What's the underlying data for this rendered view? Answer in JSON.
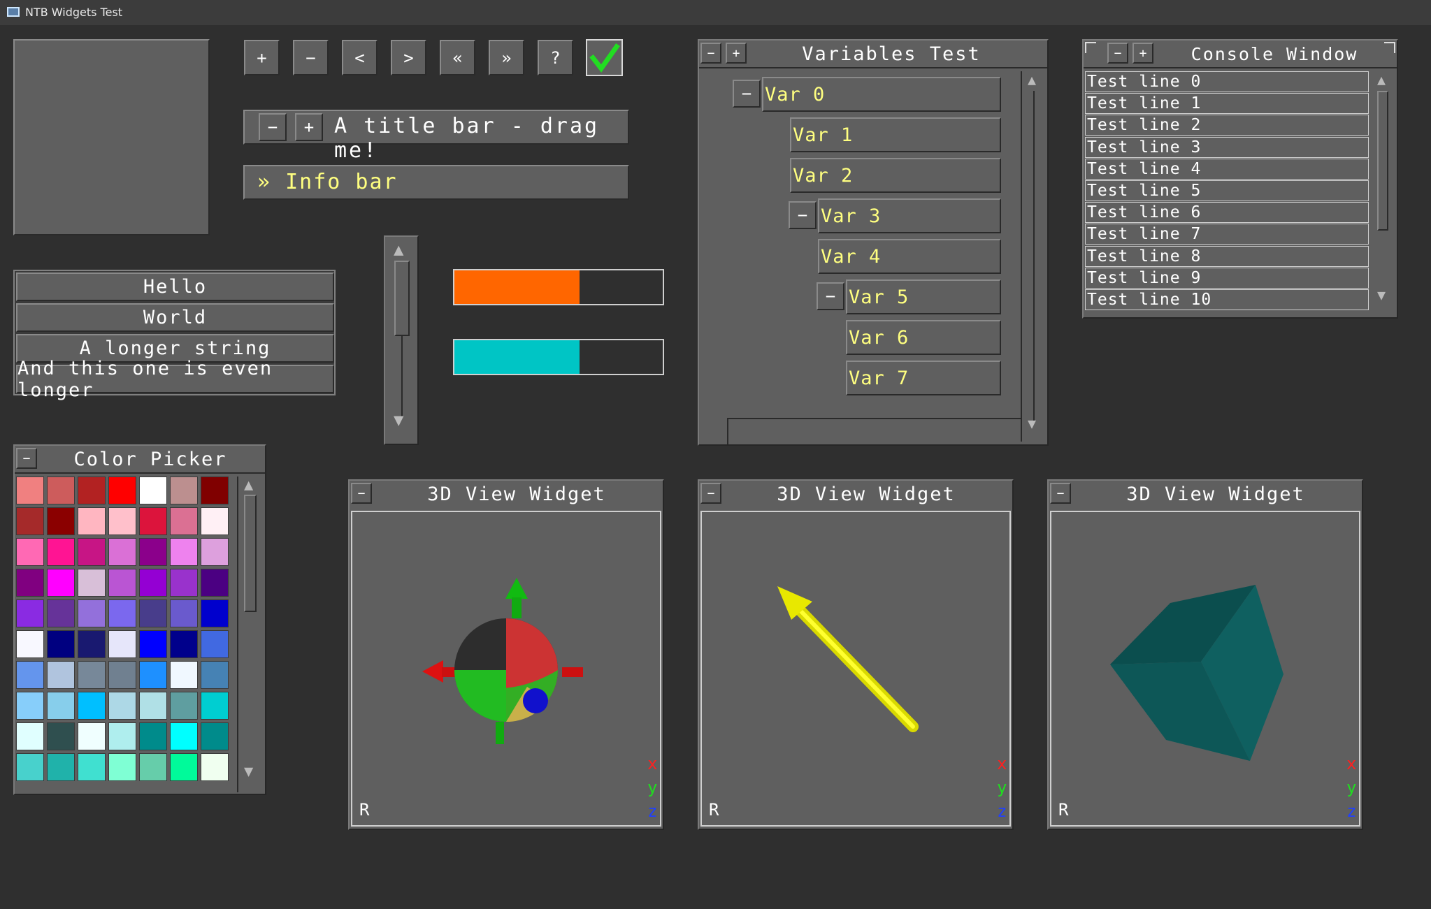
{
  "window": {
    "title": "NTB Widgets Test"
  },
  "toolbar": {
    "buttons": [
      "+",
      "−",
      "<",
      ">",
      "«",
      "»",
      "?"
    ],
    "check_color": "#22dd22"
  },
  "title_bar": {
    "minus": "−",
    "plus": "+",
    "label": "A title bar - drag me!"
  },
  "info_bar": {
    "label": "» Info bar"
  },
  "list_items": [
    "Hello",
    "World",
    "A longer string",
    "And this one is even longer"
  ],
  "progress": [
    {
      "value": 0.6,
      "color": "#ff6600"
    },
    {
      "value": 0.6,
      "color": "#00c5c5"
    }
  ],
  "variables": {
    "title": "Variables Test",
    "minus": "−",
    "plus": "+",
    "items": [
      {
        "label": "Var 0",
        "toggle": "−"
      },
      {
        "label": "Var 1",
        "toggle": ""
      },
      {
        "label": "Var 2",
        "toggle": ""
      },
      {
        "label": "Var 3",
        "toggle": "−"
      },
      {
        "label": "Var 4",
        "toggle": ""
      },
      {
        "label": "Var 5",
        "toggle": "−"
      },
      {
        "label": "Var 6",
        "toggle": ""
      },
      {
        "label": "Var 7",
        "toggle": ""
      }
    ]
  },
  "console": {
    "title": "Console Window",
    "minus": "−",
    "plus": "+",
    "lines": [
      "Test line 0",
      "Test line 1",
      "Test line 2",
      "Test line 3",
      "Test line 4",
      "Test line 5",
      "Test line 6",
      "Test line 7",
      "Test line 8",
      "Test line 9",
      "Test line 10"
    ]
  },
  "color_picker": {
    "title": "Color Picker",
    "minus": "−",
    "colors": [
      "#f08080",
      "#cd5c5c",
      "#b22222",
      "#ff0000",
      "#ffffff",
      "#bc8f8f",
      "#800000",
      "#a52a2a",
      "#8b0000",
      "#ffb6c1",
      "#ffc0cb",
      "#dc143c",
      "#db7093",
      "#fff0f5",
      "#ff69b4",
      "#ff1493",
      "#c71585",
      "#da70d6",
      "#8b008b",
      "#ee82ee",
      "#dda0dd",
      "#800080",
      "#ff00ff",
      "#d8bfd8",
      "#ba55d3",
      "#9400d3",
      "#9932cc",
      "#4b0082",
      "#8a2be2",
      "#663399",
      "#9370db",
      "#7b68ee",
      "#483d8b",
      "#6a5acd",
      "#0000cd",
      "#f8f8ff",
      "#000080",
      "#191970",
      "#e6e6fa",
      "#0000ff",
      "#00008b",
      "#4169e1",
      "#6495ed",
      "#b0c4de",
      "#778899",
      "#708090",
      "#1e90ff",
      "#f0f8ff",
      "#4682b4",
      "#87cefa",
      "#87ceeb",
      "#00bfff",
      "#add8e6",
      "#b0e0e6",
      "#5f9ea0",
      "#00ced1",
      "#e0ffff",
      "#2f4f4f",
      "#f0ffff",
      "#afeeee",
      "#008b8b",
      "#00ffff",
      "#008b8b",
      "#48d1cc",
      "#20b2aa",
      "#40e0d0",
      "#7fffd4",
      "#66cdaa",
      "#00fa9a",
      "#f0fff0"
    ]
  },
  "view3d": [
    {
      "title": "3D View Widget",
      "minus": "−",
      "reset": "R",
      "x": "x",
      "y": "y",
      "z": "z"
    },
    {
      "title": "3D View Widget",
      "minus": "−",
      "reset": "R",
      "x": "x",
      "y": "y",
      "z": "z"
    },
    {
      "title": "3D View Widget",
      "minus": "−",
      "reset": "R",
      "x": "x",
      "y": "y",
      "z": "z"
    }
  ],
  "scroll_icons": {
    "up": "▲",
    "down": "▼"
  }
}
